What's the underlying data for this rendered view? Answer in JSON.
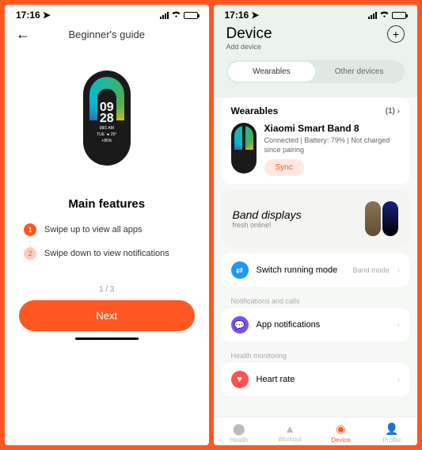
{
  "status": {
    "time": "17:16"
  },
  "left": {
    "header": "Beginner's guide",
    "band": {
      "time_top": "09",
      "time_bot": "28",
      "sub1": "08/1   AM",
      "sub2": "TUE ◄ 25°",
      "sub3": "+85%"
    },
    "heading": "Main features",
    "tips": [
      {
        "n": "1",
        "text": "Swipe up to view all apps"
      },
      {
        "n": "2",
        "text": "Swipe down to view notifications"
      }
    ],
    "pager": "1 / 3",
    "next": "Next"
  },
  "right": {
    "title": "Device",
    "subtitle": "Add device",
    "seg": {
      "a": "Wearables",
      "b": "Other devices"
    },
    "wearables": {
      "label": "Wearables",
      "count": "(1)",
      "device_name": "Xiaomi Smart Band 8",
      "device_status": "Connected | Battery: 79% | Not charged since pairing",
      "sync": "Sync"
    },
    "banner": {
      "title": "Band displays",
      "sub": "fresh online!"
    },
    "items": {
      "switch": {
        "label": "Switch running mode",
        "meta": "Band mode"
      },
      "notif_section": "Notifications and calls",
      "app_notif": "App notifications",
      "health_section": "Health monitoring",
      "heart": "Heart rate"
    },
    "tabs": {
      "health": "Health",
      "workout": "Workout",
      "device": "Device",
      "profile": "Profile"
    }
  }
}
